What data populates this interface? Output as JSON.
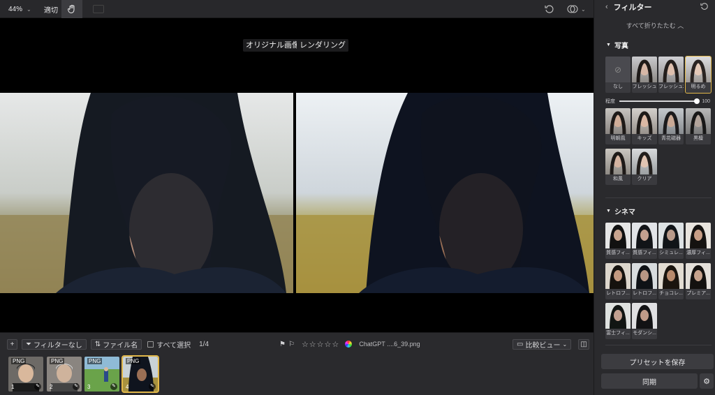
{
  "toolbar": {
    "zoom": "44%",
    "fit": "適切"
  },
  "canvas": {
    "original_label": "オリジナル画像",
    "render_label": "レンダリング"
  },
  "bottom": {
    "filter_btn": "フィルターなし",
    "filename_btn": "ファイル名",
    "select_all": "すべて選択",
    "count": "1/4",
    "filename": "ChatGPT ....6_39.png",
    "view_btn": "比較ビュー",
    "thumbs": [
      {
        "type": "PNG",
        "num": "1"
      },
      {
        "type": "PNG",
        "num": "2"
      },
      {
        "type": "PNG",
        "num": "3"
      },
      {
        "type": "PNG",
        "num": "4"
      }
    ]
  },
  "panel": {
    "title": "フィルター",
    "collapse_all": "すべて折りたたむ",
    "section_photo": "写真",
    "section_cinema": "シネマ",
    "slider_label": "程度",
    "slider_value": "100",
    "photo_presets": [
      "なし",
      "フレッシュ",
      "フレッシュ2",
      "明るめ",
      "明朝風",
      "キッズ",
      "青花磁器",
      "黒檀",
      "和風",
      "クリア"
    ],
    "cinema_presets": [
      "質感フィ...",
      "質感フィ...",
      "シミュレ...",
      "濃厚フィ...",
      "レトロフ...",
      "レトロフ...",
      "チョコレ...",
      "プレミア...",
      "富士フィ...",
      "モダンシ..."
    ],
    "save_preset": "プリセットを保存",
    "sync": "同期"
  },
  "colors": {
    "accent": "#e2b84a",
    "panel": "#2a2a2d",
    "canvas": "#000000"
  }
}
